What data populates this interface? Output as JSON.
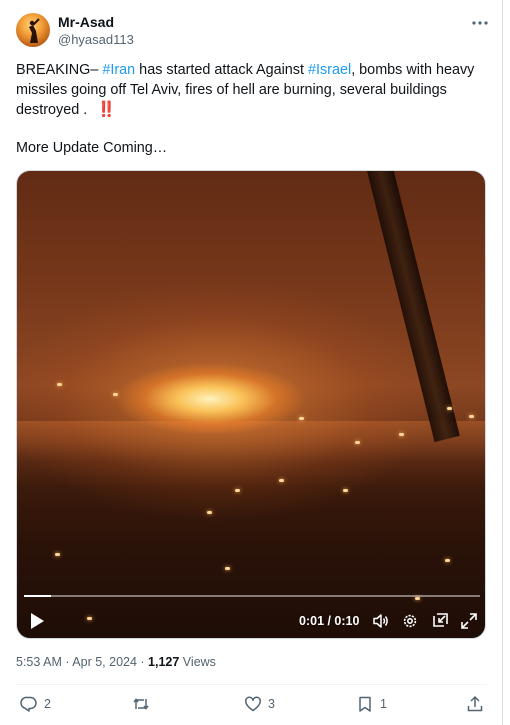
{
  "author": {
    "name": "Mr-Asad",
    "handle": "@hyasad113"
  },
  "tweet": {
    "text_parts": {
      "prefix": "BREAKING– ",
      "tag1": "#Iran",
      "middle": " has started attack Against ",
      "tag2": "#Israel",
      "suffix": ", bombs with heavy missiles going off Tel Aviv, fires of hell are burning, several buildings destroyed . ",
      "emoji": "‼️"
    },
    "update_line": "More Update Coming…"
  },
  "video": {
    "time": "0:01 / 0:10",
    "progress_fraction": 0.06
  },
  "meta": {
    "time": "5:53 AM",
    "sep1": " · ",
    "date": "Apr 5, 2024",
    "sep2": " · ",
    "views_count": "1,127",
    "views_label": " Views"
  },
  "actions": {
    "reply_count": "2",
    "retweet_count": "",
    "like_count": "3",
    "bookmark_count": "1"
  },
  "colors": {
    "link": "#1d9bf0",
    "secondary_text": "#536471",
    "primary_text": "#0f1419"
  },
  "icons": [
    "more-icon",
    "play-icon",
    "volume-icon",
    "settings-icon",
    "pip-icon",
    "fullscreen-icon",
    "reply-icon",
    "retweet-icon",
    "like-icon",
    "bookmark-icon",
    "share-icon"
  ]
}
